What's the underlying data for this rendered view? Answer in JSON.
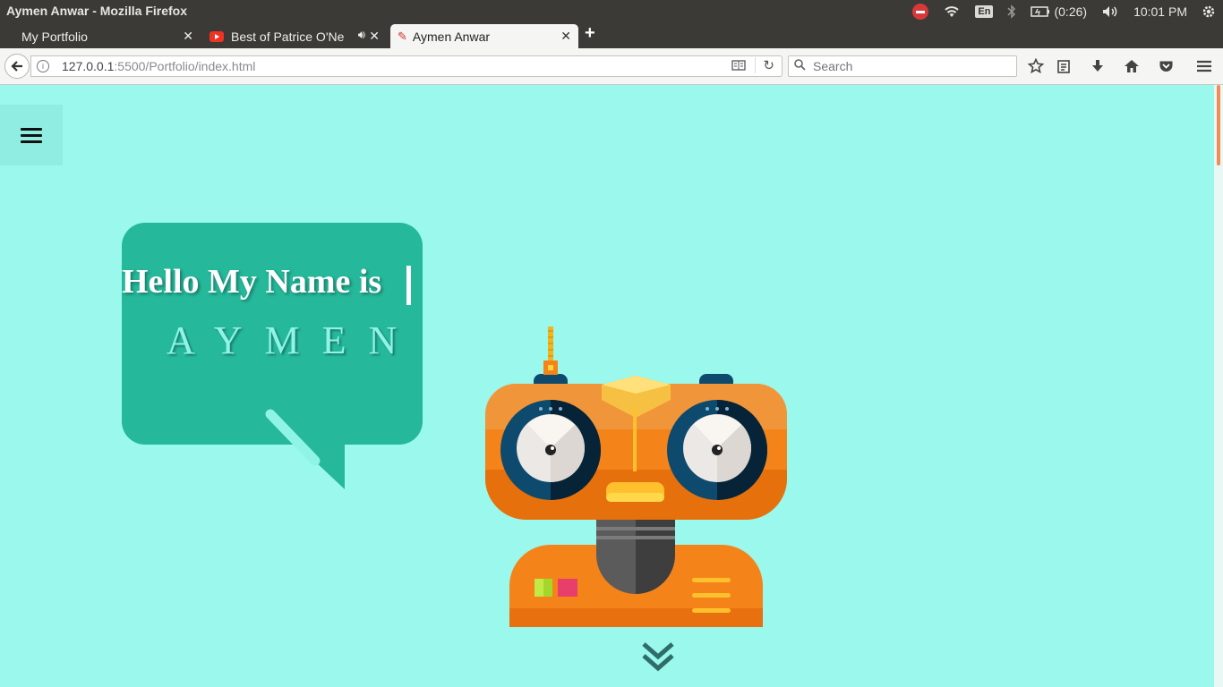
{
  "window": {
    "title": "Aymen Anwar - Mozilla Firefox"
  },
  "tray": {
    "lang": "En",
    "battery": "(0:26)",
    "time": "10:01 PM"
  },
  "tabs": [
    {
      "label": "My Portfolio"
    },
    {
      "label": "Best of Patrice O'Ne"
    },
    {
      "label": "Aymen Anwar"
    }
  ],
  "navbar": {
    "url_host": "127.0.0.1",
    "url_rest": ":5500/Portfolio/index.html",
    "search_placeholder": "Search"
  },
  "hero": {
    "greeting": "Hello My Name is",
    "name": "AYMEN"
  },
  "colors": {
    "page_bg": "#9af8ec",
    "bubble": "#25b89a",
    "robot_orange": "#f4841a"
  },
  "icons": [
    "menu-icon",
    "chevron-double-down-icon",
    "robot-illustration"
  ]
}
